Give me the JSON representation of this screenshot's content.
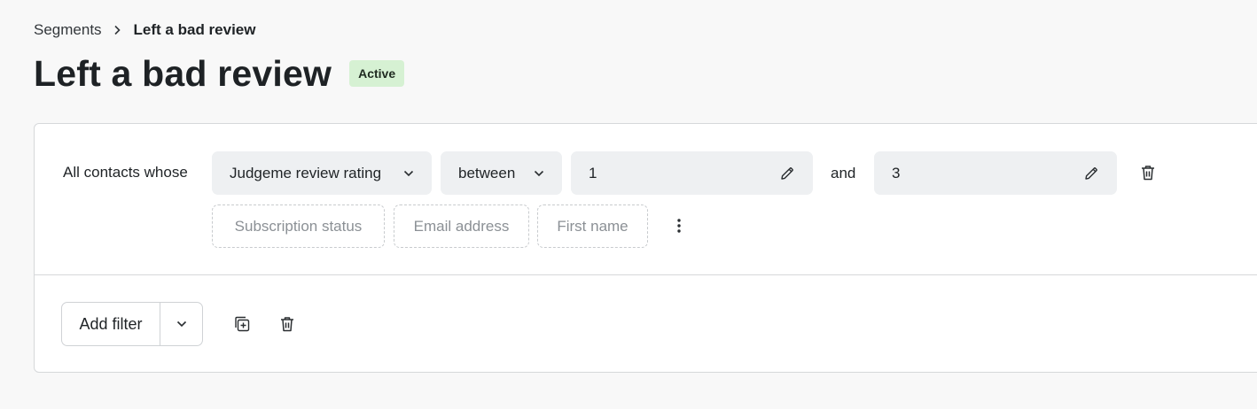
{
  "breadcrumb": {
    "parent": "Segments",
    "current": "Left a bad review"
  },
  "header": {
    "title": "Left a bad review",
    "status": "Active",
    "status_color": "#d6f1d3"
  },
  "condition": {
    "prefix": "All contacts whose",
    "field": "Judgeme review rating",
    "operator": "between",
    "value_from": "1",
    "conjunction": "and",
    "value_to": "3",
    "suggestions": [
      "Subscription status",
      "Email address",
      "First name"
    ]
  },
  "footer": {
    "add_filter_label": "Add filter"
  },
  "icons": {
    "breadcrumb_separator": "chevron-right-icon",
    "dropdown": "chevron-down-icon",
    "edit": "pencil-icon",
    "delete": "trash-icon",
    "more": "more-vertical-icon",
    "duplicate": "duplicate-plus-icon"
  }
}
